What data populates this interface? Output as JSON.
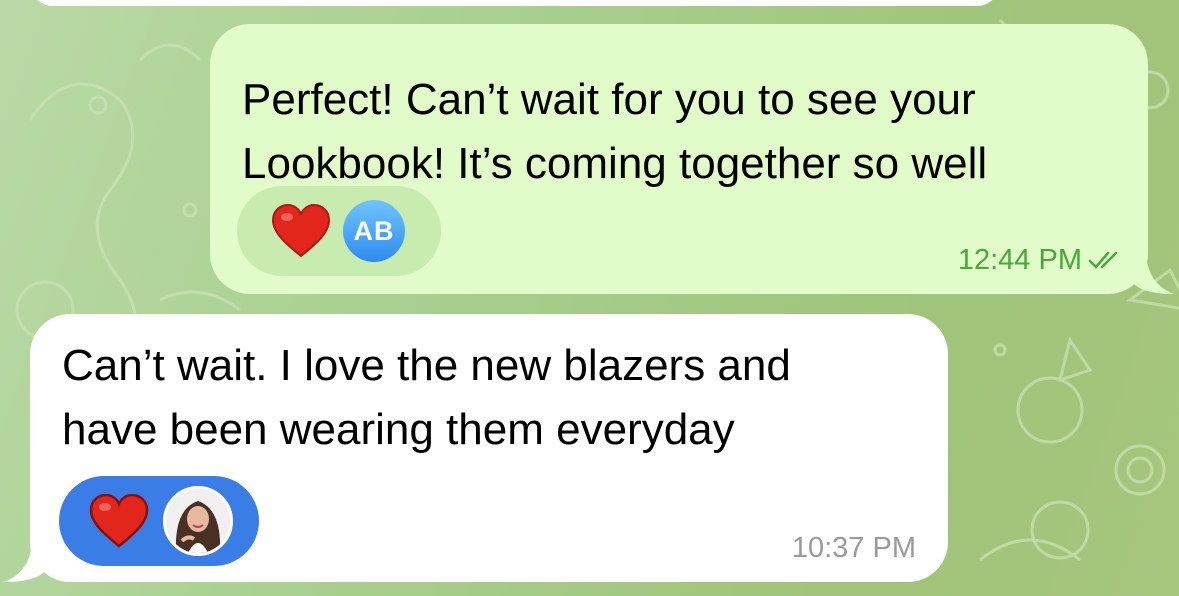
{
  "chat": {
    "outgoing": {
      "text": "Perfect! Can’t wait for you to see your\nLookbook! It’s coming together so well",
      "time": "12:44 PM",
      "read_status": "double-check-icon",
      "reactions": {
        "emoji": "heart",
        "avatar_initials": "AB"
      }
    },
    "incoming": {
      "text": "Can’t wait. I love the new blazers and\nhave been wearing them everyday",
      "time": "10:37 PM",
      "reactions": {
        "emoji": "heart",
        "avatar": "profile-photo"
      }
    }
  },
  "colors": {
    "outgoing_bubble": "#e1fbc9",
    "incoming_bubble": "#ffffff",
    "outgoing_time": "#4aa83a",
    "incoming_reaction_pill": "#3a7de6",
    "heart": "#e3261c"
  }
}
